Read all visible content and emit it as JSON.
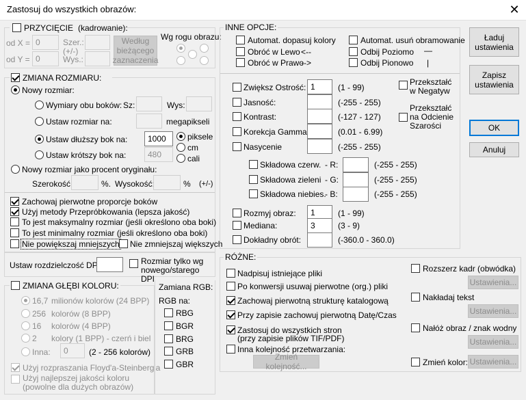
{
  "window": {
    "title": "Zastosuj do wszystkich obrazów:",
    "close_glyph": "✕"
  },
  "crop": {
    "label": "PRZYCIĘCIE",
    "hint": "(kadrowanie):",
    "x_label": "od X =",
    "x_value": "0",
    "y_label": "od Y =",
    "y_value": "0",
    "w_label": "Szer.:",
    "pm_label": "(+/-)",
    "h_label": "Wys.:",
    "by_current_button": "Według bieżącego zaznaczenia",
    "corner_label": "Wg rogu obrazu:"
  },
  "resize": {
    "label": "ZMIANA ROZMIARU:",
    "new_size": "Nowy rozmiar:",
    "both_sides": "Wymiary obu boków:",
    "sz_label": "Sz:",
    "wys_label": "Wys:",
    "set_size_to": "Ustaw rozmiar na:",
    "megapixels": "megapikseli",
    "longer_side": "Ustaw dłuższy bok na:",
    "longer_value": "1000",
    "shorter_side": "Ustaw krótszy bok na:",
    "shorter_value": "480",
    "units": [
      "piksele",
      "cm",
      "cali"
    ],
    "percent_label": "Nowy rozmiar jako procent oryginału:",
    "width_label": "Szerokość:",
    "percent_sign": "%.",
    "height_label": "Wysokość:",
    "percent_sign2": "%",
    "pm": "(+/-)",
    "keep_ratio": "Zachowaj pierwotne proporcje boków",
    "resample": "Użyj metody Przepróbkowania (lepsza jakość)",
    "max_size": "To jest maksymalny rozmiar (jeśli określono oba boki)",
    "min_size": "To jest minimalny rozmiar (jeśli określono oba boki)",
    "no_enlarge": "Nie powiększaj mniejszych",
    "no_shrink": "Nie zmniejszaj większych"
  },
  "dpi": {
    "label": "Ustaw rozdzielczość DPI:",
    "only_label": "Rozmiar tylko wg nowego/starego DPI"
  },
  "color_depth": {
    "label": "ZMIANA GŁĘBI KOLORU:",
    "options": [
      {
        "num": "16,7",
        "text": "milionów kolorów (24 BPP)"
      },
      {
        "num": "256",
        "text": "kolorów (8 BPP)"
      },
      {
        "num": "16",
        "text": "kolorów (4 BPP)"
      },
      {
        "num": "2",
        "text": "kolory   (1 BPP) - czerń i biel"
      }
    ],
    "other_label": "Inna:",
    "other_value": "0",
    "other_range": "(2 - 256 kolorów)",
    "dither": "Użyj rozpraszania Floyd'a-Steinberg'a",
    "best_quality": "Użyj najlepszej jakości koloru (powolne dla dużych obrazów)"
  },
  "rgb_swap": {
    "label": "Zamiana RGB:",
    "sub": "RGB na:",
    "options": [
      "RBG",
      "BGR",
      "BRG",
      "GRB",
      "GBR"
    ]
  },
  "other_options": {
    "label": "INNE OPCJE:",
    "auto_colors": "Automat. dopasuj kolory",
    "auto_border": "Automat. usuń obramowanie",
    "rotate_left": "Obróć w Lewo",
    "rotate_left_arrow": "<--",
    "flip_h": "Odbij Poziomo",
    "flip_h_glyph": "—",
    "rotate_right": "Obróć w Prawo",
    "rotate_right_arrow": "-->",
    "flip_v": "Odbij Pionowo",
    "flip_v_glyph": "|",
    "sharpen": "Zwiększ Ostrość:",
    "sharpen_value": "1",
    "sharpen_range": "(1  -  99)",
    "brightness": "Jasność:",
    "brightness_range": "(-255  -  255)",
    "contrast": "Kontrast:",
    "contrast_range": "(-127  -  127)",
    "gamma": "Korekcja Gamma:",
    "gamma_range": "(0.01  -  6.99)",
    "saturation": "Nasycenie",
    "saturation_range": "(-255  -  255)",
    "negative": "Przekształć w Negatyw",
    "grayscale": "Przekształć na Odcienie Szarości",
    "red": "Składowa czerw.",
    "red_ch": "- R:",
    "red_range": "(-255  -  255)",
    "green": "Składowa zieleni",
    "green_ch": "- G:",
    "green_range": "(-255  -  255)",
    "blue": "Składowa niebies.",
    "blue_ch": "- B:",
    "blue_range": "(-255  -  255)",
    "blur": "Rozmyj obraz:",
    "blur_value": "1",
    "blur_range": "(1  -  99)",
    "median": "Mediana:",
    "median_value": "3",
    "median_range": "(3  -  9)",
    "rotate_exact": "Dokładny obrót:",
    "rotate_exact_range": "(-360.0  -  360.0)"
  },
  "misc": {
    "label": "RÓŻNE:",
    "overwrite": "Nadpisuj istniejące pliki",
    "delete_orig": "Po konwersji usuwaj pierwotne (org.) pliki",
    "keep_folders": "Zachowaj pierwotną strukturę katalogową",
    "keep_date": "Przy zapisie zachowuj pierwotną Datę/Czas",
    "all_pages": "Zastosuj do wszystkich stron",
    "all_pages_sub": "(przy zapisie plików TIF/PDF)",
    "other_order": "Inna kolejność przetwarzania:",
    "change_order_btn": "Zmień kolejność...",
    "canvas": "Rozszerz kadr (obwódka)",
    "text": "Nakładaj tekst",
    "watermark": "Nałóż obraz / znak wodny",
    "change_color": "Zmień kolor:",
    "settings_btn": "Ustawienia..."
  },
  "buttons": {
    "load": "Ładuj ustawienia",
    "save": "Zapisz ustawienia",
    "ok": "OK",
    "cancel": "Anuluj"
  }
}
